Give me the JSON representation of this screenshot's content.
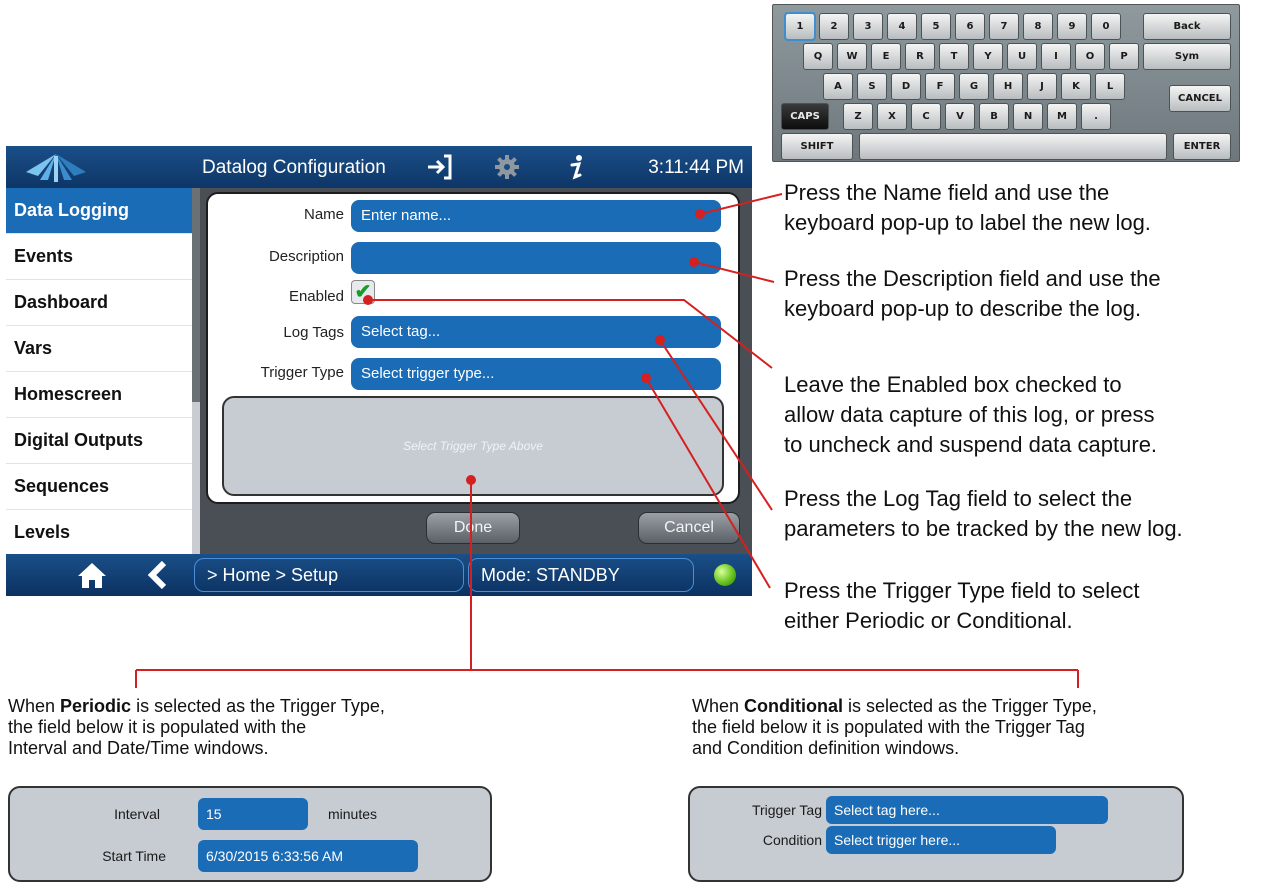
{
  "keyboard": {
    "row1": [
      "1",
      "2",
      "3",
      "4",
      "5",
      "6",
      "7",
      "8",
      "9",
      "0",
      "Back"
    ],
    "row2": [
      "Q",
      "W",
      "E",
      "R",
      "T",
      "Y",
      "U",
      "I",
      "O",
      "P",
      "Sym"
    ],
    "row3": [
      "A",
      "S",
      "D",
      "F",
      "G",
      "H",
      "J",
      "K",
      "L",
      "CANCEL"
    ],
    "row4": [
      "CAPS",
      "Z",
      "X",
      "C",
      "V",
      "B",
      "N",
      "M",
      "."
    ],
    "row5": [
      "SHIFT",
      "ENTER"
    ]
  },
  "header": {
    "title": "Datalog Configuration",
    "time": "3:11:44 PM"
  },
  "sidebar": {
    "items": [
      {
        "label": "Data Logging",
        "active": true
      },
      {
        "label": "Events"
      },
      {
        "label": "Dashboard"
      },
      {
        "label": "Vars"
      },
      {
        "label": "Homescreen"
      },
      {
        "label": "Digital Outputs"
      },
      {
        "label": "Sequences"
      },
      {
        "label": "Levels"
      }
    ]
  },
  "form": {
    "name_label": "Name",
    "name_placeholder": "Enter name...",
    "description_label": "Description",
    "description_value": "",
    "enabled_label": "Enabled",
    "enabled": true,
    "log_tags_label": "Log Tags",
    "log_tags_placeholder": "Select tag...",
    "trigger_type_label": "Trigger Type",
    "trigger_type_placeholder": "Select trigger type...",
    "trigger_area_text": "Select Trigger Type Above"
  },
  "buttons": {
    "done": "Done",
    "cancel": "Cancel"
  },
  "footer": {
    "breadcrumb": "> Home > Setup",
    "mode": "Mode: STANDBY"
  },
  "callouts": {
    "name": [
      "Press the Name field and use the",
      "keyboard pop-up to label the new log."
    ],
    "description": [
      "Press the Description field and use the",
      "keyboard pop-up to describe the log."
    ],
    "enabled": [
      "Leave the Enabled box checked to",
      "allow data capture of this log, or press",
      "to uncheck and suspend data capture."
    ],
    "log_tag": [
      "Press the Log Tag field to select the",
      "parameters to be tracked by the new log."
    ],
    "trigger_type": [
      "Press the Trigger Type field to select",
      "either Periodic or Conditional."
    ]
  },
  "periodic": {
    "note_prefix": "When ",
    "note_bold": "Periodic",
    "note_rest": " is selected as the Trigger Type,",
    "note_line2": "the field below it is populated with the",
    "note_line3": "Interval and Date/Time windows.",
    "interval_label": "Interval",
    "interval_value": "15",
    "interval_unit": "minutes",
    "start_time_label": "Start Time",
    "start_time_value": "6/30/2015 6:33:56 AM"
  },
  "conditional": {
    "note_prefix": "When ",
    "note_bold": "Conditional",
    "note_rest": " is selected as the Trigger Type,",
    "note_line2": "the field below it is populated with the Trigger Tag",
    "note_line3": "and Condition definition windows.",
    "trigger_tag_label": "Trigger Tag",
    "trigger_tag_placeholder": "Select tag here...",
    "condition_label": "Condition",
    "condition_placeholder": "Select trigger here..."
  },
  "colors": {
    "accent_blue": "#1a6cb6",
    "callout_line": "#d42020",
    "header_blue": "#154a82"
  }
}
